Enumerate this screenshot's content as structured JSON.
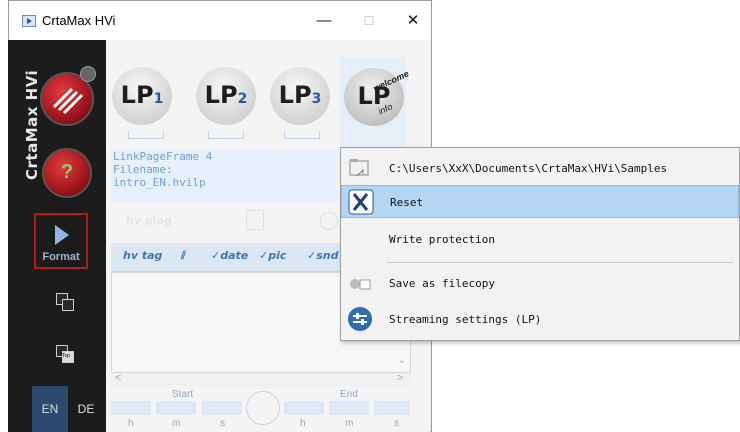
{
  "window": {
    "title": "CrtaMax HVi",
    "minimize": "—",
    "maximize": "☐",
    "close": "✕"
  },
  "sidebar": {
    "vertical_title": "CrtaMax HVi",
    "help_glyph": "?",
    "format_label": "Format",
    "top_icon_glyph": "Top",
    "languages": [
      "EN",
      "DE"
    ],
    "active_language": "EN"
  },
  "lp_buttons": [
    {
      "prefix": "LP",
      "number": "1"
    },
    {
      "prefix": "LP",
      "number": "2"
    },
    {
      "prefix": "LP",
      "number": "3"
    }
  ],
  "welcome_lp": {
    "prefix": "LP",
    "top": "welcome",
    "bottom": "info"
  },
  "info": {
    "line1": "LinkPageFrame 4",
    "line2": "Filename:",
    "line3": "intro_EN.hvilp"
  },
  "ghost_toolbar": {
    "playtag": "hv plag"
  },
  "tag_bar": [
    "hv tag",
    "✓date",
    "✓pic",
    "✓snd"
  ],
  "time_panel": {
    "start_label": "Start",
    "end_label": "End",
    "units": [
      "h",
      "m",
      "s",
      "h",
      "m",
      "s"
    ]
  },
  "context_menu": {
    "items": [
      {
        "label": "C:\\Users\\XxX\\Documents\\CrtaMax\\HVi\\Samples",
        "icon": "folder-icon",
        "selected": false
      },
      {
        "label": "Reset",
        "icon": "x-mark-icon",
        "selected": true
      },
      {
        "label": "Write protection",
        "icon": "",
        "selected": false
      },
      {
        "label": "Save as filecopy",
        "icon": "filecopy-icon",
        "selected": false
      },
      {
        "label": "Streaming settings (LP)",
        "icon": "sliders-icon",
        "selected": false
      }
    ]
  },
  "colors": {
    "sidebar_bg": "#1c1c1c",
    "accent_blue": "#3a76b7",
    "menu_highlight": "#b5d6f3",
    "format_border": "#b11c1c",
    "lang_active_bg": "#2b4a6e"
  }
}
